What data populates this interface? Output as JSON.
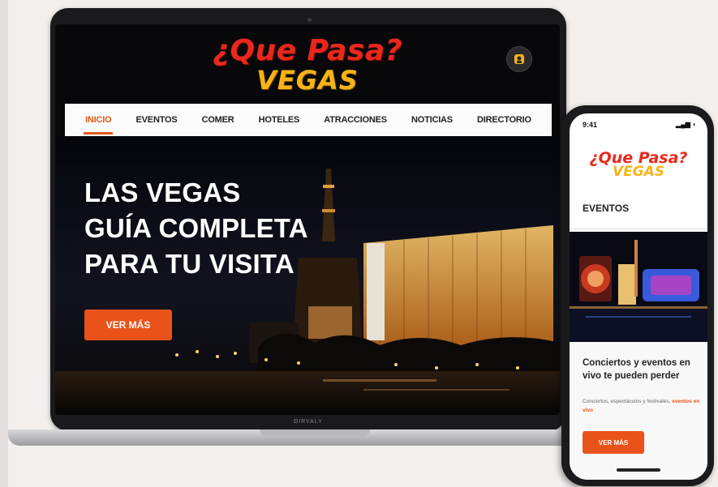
{
  "laptop": {
    "logo": {
      "line1": "¿Que Pasa?",
      "line2": "VEGAS"
    },
    "nav": {
      "items": [
        "INICIO",
        "EVENTOS",
        "COMER",
        "HOTELES",
        "ATRACCIONES",
        "NOTICIAS",
        "DIRECTORIO"
      ],
      "active_index": 0
    },
    "hero": {
      "lines": [
        "LAS VEGAS",
        "GUÍA COMPLETA",
        "PARA TU VISITA"
      ],
      "button_label": "VER MÁS"
    },
    "user_icon": "user-icon",
    "brand_label": "DIRVALY"
  },
  "phone": {
    "status": {
      "time": "9:41",
      "icons": "▂▄▆ ◖"
    },
    "logo": {
      "line1": "¿Que Pasa?",
      "line2": "VEGAS"
    },
    "section_title": "EVENTOS",
    "card": {
      "title": "Conciertos y eventos en vivo te pueden perder",
      "body_text": "Conciertos, espectáculos y festivales,",
      "body_highlight": "eventos en vivo",
      "button_label": "VER MÁS"
    }
  },
  "colors": {
    "accent": "#e9531a",
    "logo_red": "#e8281c",
    "logo_gold": "#f6b417",
    "screen_bg": "#08080a"
  }
}
